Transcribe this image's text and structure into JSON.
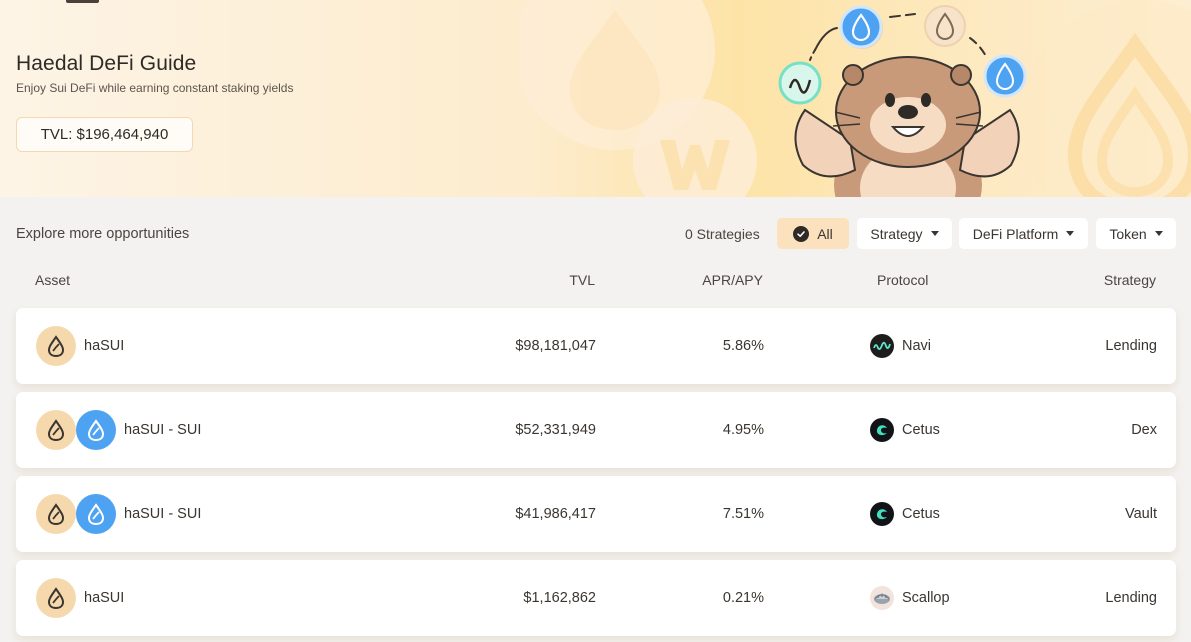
{
  "hero": {
    "title": "Haedal DeFi Guide",
    "subtitle": "Enjoy Sui DeFi while earning constant staking yields",
    "tvl": "TVL: $196,464,940"
  },
  "filters": {
    "explore_label": "Explore more opportunities",
    "strategy_count": "0 Strategies",
    "all_label": "All",
    "strategy_label": "Strategy",
    "platform_label": "DeFi Platform",
    "token_label": "Token"
  },
  "table": {
    "headers": {
      "asset": "Asset",
      "tvl": "TVL",
      "apr": "APR/APY",
      "protocol": "Protocol",
      "strategy": "Strategy"
    },
    "rows": [
      {
        "asset": "haSUI",
        "tvl": "$98,181,047",
        "apr": "5.86%",
        "protocol": "Navi",
        "strategy": "Lending"
      },
      {
        "asset": "haSUI - SUI",
        "tvl": "$52,331,949",
        "apr": "4.95%",
        "protocol": "Cetus",
        "strategy": "Dex"
      },
      {
        "asset": "haSUI - SUI",
        "tvl": "$41,986,417",
        "apr": "7.51%",
        "protocol": "Cetus",
        "strategy": "Vault"
      },
      {
        "asset": "haSUI",
        "tvl": "$1,162,862",
        "apr": "0.21%",
        "protocol": "Scallop",
        "strategy": "Lending"
      }
    ]
  },
  "icons": {
    "hasui": "hasui-token-icon",
    "sui": "sui-token-icon",
    "navi": "navi-logo-icon",
    "cetus": "cetus-logo-icon",
    "scallop": "scallop-logo-icon",
    "mascot": "otter-mascot-illustration"
  },
  "colors": {
    "accent": "#fbe1bd",
    "hasui_bg": "#f6d8ad",
    "sui_blue": "#4da2f2",
    "cetus_teal": "#3fe0c0"
  }
}
